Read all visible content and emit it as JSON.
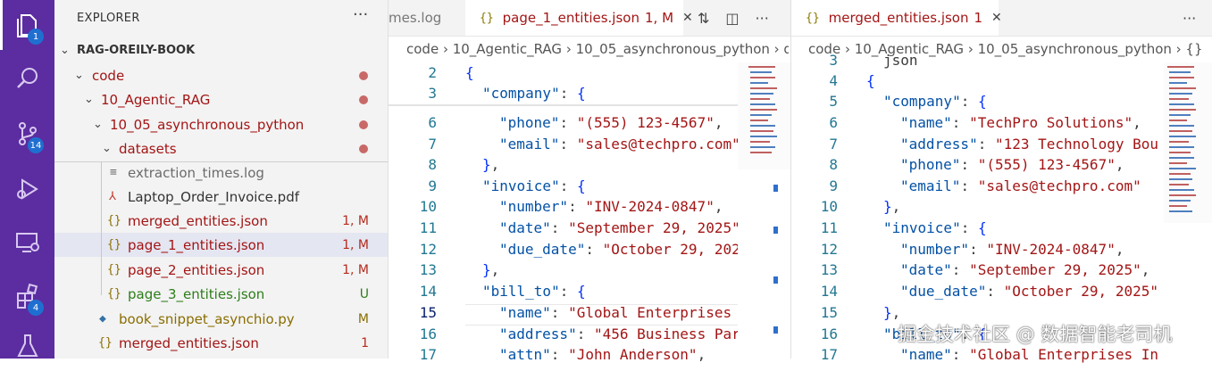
{
  "activity_bar": {
    "explorer_badge": "1",
    "scm_badge": "14",
    "extensions_badge": "4"
  },
  "explorer": {
    "title": "EXPLORER",
    "more": "···",
    "root": "RAG-OREILY-BOOK",
    "folders": [
      "code",
      "10_Agentic_RAG",
      "10_05_asynchronous_python",
      "datasets"
    ],
    "files": [
      {
        "name": "extraction_times.log",
        "status": ""
      },
      {
        "name": "Laptop_Order_Invoice.pdf",
        "status": ""
      },
      {
        "name": "merged_entities.json",
        "status": "1, M"
      },
      {
        "name": "page_1_entities.json",
        "status": "1, M"
      },
      {
        "name": "page_2_entities.json",
        "status": "1, M"
      },
      {
        "name": "page_3_entities.json",
        "status": "U"
      },
      {
        "name": "book_snippet_asynchio.py",
        "status": "M"
      },
      {
        "name": "merged_entities.json",
        "status": "1"
      }
    ]
  },
  "left_editor": {
    "prev_tab": "mes.log",
    "tab_name": "page_1_entities.json",
    "tab_status": "1, M",
    "breadcrumb": "code › 10_Agentic_RAG › 10_05_asynchronous_python › da",
    "line_numbers": [
      "2",
      "3",
      "6",
      "7",
      "8",
      "9",
      "10",
      "11",
      "12",
      "13",
      "14",
      "15",
      "16",
      "17"
    ],
    "lines": [
      "{",
      "\"company\": {",
      "\"phone\": \"(555) 123-4567\", ",
      "\"email\": \"sales@techpro.com\"",
      "},",
      "\"invoice\": {",
      "\"number\": \"INV-2024-0847\",",
      "\"date\": \"September 29, 2025\"",
      "\"due_date\": \"October 29, 202",
      "},",
      "\"bill_to\": {",
      "\"name\": \"Global Enterprises ",
      "\"address\": \"456 Business Par",
      "\"attn\": \"John Anderson\","
    ]
  },
  "right_editor": {
    "tab_name": "merged_entities.json",
    "tab_status": "1",
    "breadcrumb": "code › 10_Agentic_RAG › 10_05_asynchronous_python › {}",
    "line_numbers": [
      "3",
      "4",
      "5",
      "6",
      "7",
      "8",
      "9",
      "10",
      "11",
      "12",
      "13",
      "14",
      "15",
      "16",
      "17"
    ],
    "lines": [
      "json",
      "{",
      "\"company\": {",
      "\"name\": \"TechPro Solutions\",",
      "\"address\": \"123 Technology Bou",
      "\"phone\": \"(555) 123-4567\",",
      "\"email\": \"sales@techpro.com\"",
      "},",
      "\"invoice\": {",
      "\"number\": \"INV-2024-0847\",",
      "\"date\": \"September 29, 2025\",",
      "\"due_date\": \"October 29, 2025\"",
      "},",
      "\"bill_to\": {",
      "\"name\": \"Global Enterprises In"
    ]
  },
  "watermark": "掘金技术社区 @ 数据智能老司机"
}
